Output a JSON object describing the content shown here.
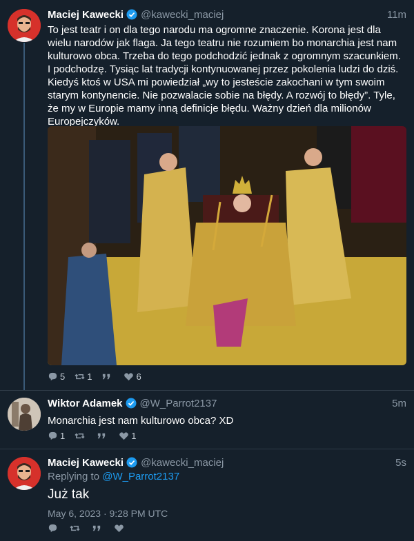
{
  "tweets": [
    {
      "author_name": "Maciej Kawecki",
      "handle": "@kawecki_maciej",
      "time": "11m",
      "text": "To jest teatr i on dla tego narodu ma ogromne znaczenie. Korona jest dla wielu narodów jak flaga. Ja tego teatru nie rozumiem bo monarchia jest nam kulturowo obca. Trzeba do tego podchodzić jednak z ogromnym szacunkiem. I podchodzę. Tysiąc lat tradycji kontynuowanej przez pokolenia ludzi do dziś. Kiedyś ktoś w USA mi powiedział „wy to jesteście zakochani w tym swoim starym kontynencie. Nie pozwalacie sobie na błędy. A rozwój to błędy”. Tyle, że my w Europie mamy inną definicje błędu. Ważny dzień dla milionów Europejczyków.",
      "replies": "5",
      "retweets": "1",
      "likes": "6",
      "image_alt": "coronation-photo"
    },
    {
      "author_name": "Wiktor Adamek",
      "handle": "@W_Parrot2137",
      "time": "5m",
      "text": "Monarchia jest nam kulturowo obca? XD",
      "replies": "1",
      "retweets": "",
      "likes": "1"
    },
    {
      "author_name": "Maciej Kawecki",
      "handle": "@kawecki_maciej",
      "time": "5s",
      "replying_prefix": "Replying to",
      "replying_handle": "@W_Parrot2137",
      "text": "Już tak",
      "timestamp": "May 6, 2023 · 9:28 PM UTC"
    }
  ],
  "colors": {
    "background": "#15202b",
    "accent": "#1d9bf0",
    "muted": "#8b98a5"
  }
}
